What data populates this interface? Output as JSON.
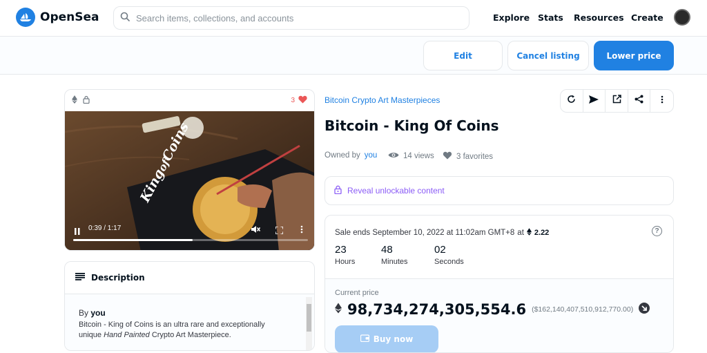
{
  "brand": {
    "name": "OpenSea",
    "accent": "#2081e2"
  },
  "search": {
    "placeholder": "Search items, collections, and accounts"
  },
  "nav": {
    "items": [
      "Explore",
      "Stats",
      "Resources",
      "Create"
    ]
  },
  "owner_actions": {
    "edit": "Edit",
    "cancel_listing": "Cancel listing",
    "lower_price": "Lower price"
  },
  "media": {
    "favorites_count": "3",
    "video_time": "0:39 / 1:17",
    "progress_fraction": 0.51
  },
  "description": {
    "heading": "Description",
    "by_prefix": "By",
    "by_user": "you",
    "line1_title": "Bitcoin - King of Coins",
    "line1_rest": " is an ultra rare and exceptionally",
    "line2_prefix": "unique ",
    "line2_italic": "Hand Painted",
    "line2_rest": " Crypto Art Masterpiece."
  },
  "item": {
    "collection": "Bitcoin Crypto Art Masterpieces",
    "title": "Bitcoin - King Of Coins",
    "owned_by_label": "Owned by",
    "owner": "you",
    "views": "14 views",
    "favorites": "3 favorites"
  },
  "unlockable": {
    "label": "Reveal unlockable content"
  },
  "sale": {
    "ends_text": "Sale ends September 10, 2022 at 11:02am GMT+8",
    "at_label": "at",
    "eth_amount": "2.22",
    "countdown": [
      {
        "value": "23",
        "unit": "Hours"
      },
      {
        "value": "48",
        "unit": "Minutes"
      },
      {
        "value": "02",
        "unit": "Seconds"
      }
    ],
    "current_price_label": "Current price",
    "price": "98,734,274,305,554.6",
    "usd": "($162,140,407,510,912,770.00)",
    "buy_label": "Buy now"
  }
}
